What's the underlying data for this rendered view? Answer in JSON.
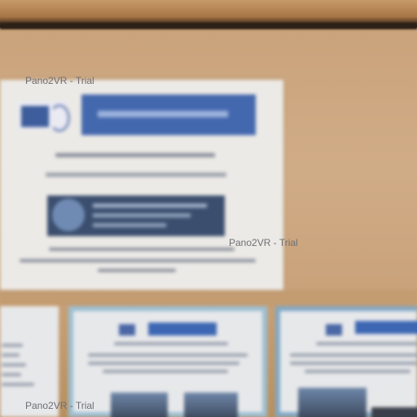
{
  "watermarks": {
    "top": "Pano2VR - Trial",
    "middle": "Pano2VR - Trial",
    "bottom": "Pano2VR - Trial"
  },
  "colors": {
    "wall": "#cfa983",
    "shelf": "#2d2117",
    "poster_paper": "#eceae6",
    "banner_blue": "#4468ae",
    "banner_dark": "#3b4e6e",
    "flyer_frame": "#9bbfd3"
  }
}
